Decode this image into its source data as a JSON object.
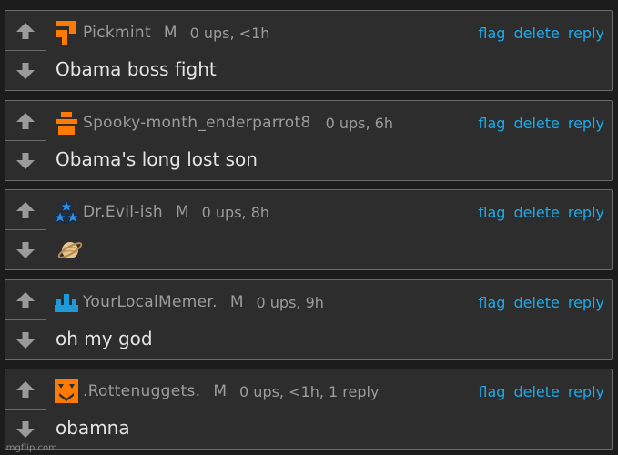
{
  "comments": [
    {
      "username": "Pickmint",
      "badge": "M",
      "stats": "0 ups, <1h",
      "body": "Obama boss fight",
      "avatar_icon": "orange-blocky-avatar-icon",
      "avatar_color": "#ff7a00",
      "actions": {
        "flag": "flag",
        "delete": "delete",
        "reply": "reply"
      }
    },
    {
      "username": "Spooky-month_enderparrot8",
      "badge": "",
      "stats": "0 ups, 6h",
      "body": "Obama's long lost son",
      "avatar_icon": "orange-stacked-bars-avatar-icon",
      "avatar_color": "#ff7a00",
      "actions": {
        "flag": "flag",
        "delete": "delete",
        "reply": "reply"
      }
    },
    {
      "username": "Dr.Evil-ish",
      "badge": "M",
      "stats": "0 ups, 8h",
      "body": "",
      "body_icon": "ringed-planet-emoji-icon",
      "avatar_icon": "blue-stars-avatar-icon",
      "avatar_color": "#2f8fe0",
      "actions": {
        "flag": "flag",
        "delete": "delete",
        "reply": "reply"
      }
    },
    {
      "username": "YourLocalMemer.",
      "badge": "M",
      "stats": "0 ups, 9h",
      "body": "oh my god",
      "avatar_icon": "blue-blocks-avatar-icon",
      "avatar_color": "#1e9bd7",
      "actions": {
        "flag": "flag",
        "delete": "delete",
        "reply": "reply"
      }
    },
    {
      "username": ".Rottenuggets.",
      "badge": "M",
      "stats": "0 ups, <1h, 1 reply",
      "body": "obamna",
      "avatar_icon": "orange-face-avatar-icon",
      "avatar_color": "#ff7a00",
      "actions": {
        "flag": "flag",
        "delete": "delete",
        "reply": "reply"
      }
    }
  ],
  "icons": {
    "upvote": "up-arrow-icon",
    "downvote": "down-arrow-icon"
  },
  "colors": {
    "background": "#1c1c1c",
    "panel": "#2d2d2d",
    "border": "#6a6a6a",
    "username": "#9c9c9c",
    "link": "#1fa9e8",
    "body_text": "#e4e4e4"
  },
  "watermark": "imgflip.com"
}
